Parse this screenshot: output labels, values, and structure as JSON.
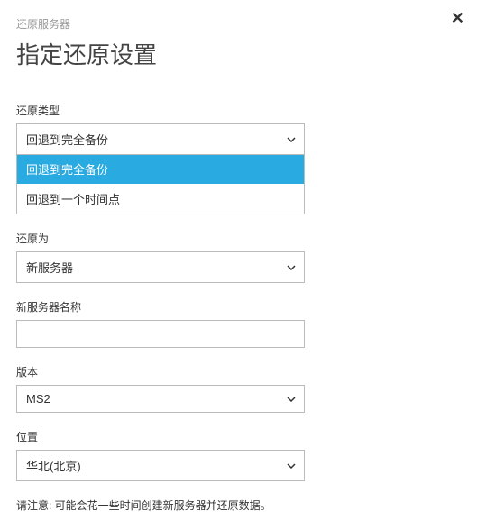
{
  "breadcrumb": "还原服务器",
  "page_title": "指定还原设置",
  "restore_type": {
    "label": "还原类型",
    "selected": "回退到完全备份",
    "options": [
      {
        "label": "回退到完全备份",
        "selected": true
      },
      {
        "label": "回退到一个时间点",
        "selected": false
      }
    ]
  },
  "restore_as": {
    "label": "还原为",
    "selected": "新服务器"
  },
  "server_name": {
    "label": "新服务器名称",
    "value": ""
  },
  "version": {
    "label": "版本",
    "selected": "MS2"
  },
  "location": {
    "label": "位置",
    "selected": "华北(北京)"
  },
  "note": "请注意: 可能会花一些时间创建新服务器并还原数据。"
}
